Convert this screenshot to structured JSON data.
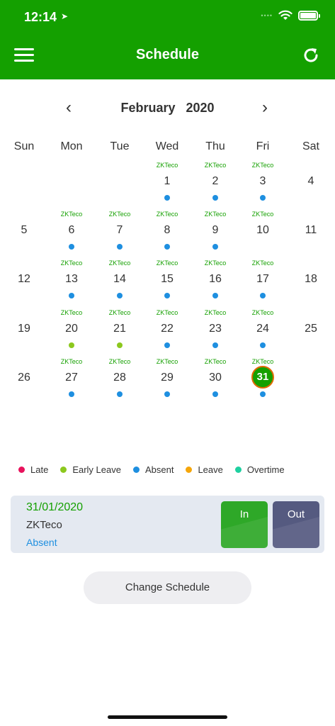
{
  "status_bar": {
    "time": "12:14",
    "signal": "••••"
  },
  "header": {
    "title": "Schedule",
    "menu_icon": "hamburger-menu-icon",
    "refresh_icon": "refresh-icon"
  },
  "calendar": {
    "month": "February",
    "year": "2020",
    "weekdays": [
      "Sun",
      "Mon",
      "Tue",
      "Wed",
      "Thu",
      "Fri",
      "Sat"
    ],
    "weeks": [
      [
        {
          "day": ""
        },
        {
          "day": ""
        },
        {
          "day": ""
        },
        {
          "day": "1",
          "tag": "ZKTeco",
          "status": "absent"
        },
        {
          "day": "2",
          "tag": "ZKTeco",
          "status": "absent"
        },
        {
          "day": "3",
          "tag": "ZKTeco",
          "status": "absent"
        },
        {
          "day": "4"
        }
      ],
      [
        {
          "day": "5"
        },
        {
          "day": "6",
          "tag": "ZKTeco",
          "status": "absent"
        },
        {
          "day": "7",
          "tag": "ZKTeco",
          "status": "absent"
        },
        {
          "day": "8",
          "tag": "ZKTeco",
          "status": "absent"
        },
        {
          "day": "9",
          "tag": "ZKTeco",
          "status": "absent"
        },
        {
          "day": "10",
          "tag": "ZKTeco"
        },
        {
          "day": "11"
        }
      ],
      [
        {
          "day": "12"
        },
        {
          "day": "13",
          "tag": "ZKTeco",
          "status": "absent"
        },
        {
          "day": "14",
          "tag": "ZKTeco",
          "status": "absent"
        },
        {
          "day": "15",
          "tag": "ZKTeco",
          "status": "absent"
        },
        {
          "day": "16",
          "tag": "ZKTeco",
          "status": "absent"
        },
        {
          "day": "17",
          "tag": "ZKTeco",
          "status": "absent"
        },
        {
          "day": "18"
        }
      ],
      [
        {
          "day": "19"
        },
        {
          "day": "20",
          "tag": "ZKTeco",
          "status": "early_leave"
        },
        {
          "day": "21",
          "tag": "ZKTeco",
          "status": "early_leave"
        },
        {
          "day": "22",
          "tag": "ZKTeco",
          "status": "absent"
        },
        {
          "day": "23",
          "tag": "ZKTeco",
          "status": "absent"
        },
        {
          "day": "24",
          "tag": "ZKTeco",
          "status": "absent"
        },
        {
          "day": "25"
        }
      ],
      [
        {
          "day": "26"
        },
        {
          "day": "27",
          "tag": "ZKTeco",
          "status": "absent"
        },
        {
          "day": "28",
          "tag": "ZKTeco",
          "status": "absent"
        },
        {
          "day": "29",
          "tag": "ZKTeco",
          "status": "absent"
        },
        {
          "day": "30",
          "tag": "ZKTeco",
          "status": "absent"
        },
        {
          "day": "31",
          "tag": "ZKTeco",
          "status": "absent",
          "selected": true
        },
        {
          "day": ""
        }
      ]
    ]
  },
  "legend": [
    {
      "key": "late",
      "label": "Late",
      "color": "#e8125c"
    },
    {
      "key": "early_leave",
      "label": "Early Leave",
      "color": "#8cc81e"
    },
    {
      "key": "absent",
      "label": "Absent",
      "color": "#1e8fe0"
    },
    {
      "key": "leave",
      "label": "Leave",
      "color": "#f5a60a"
    },
    {
      "key": "overtime",
      "label": "Overtime",
      "color": "#1ed0a0"
    }
  ],
  "record": {
    "date": "31/01/2020",
    "name": "ZKTeco",
    "status": "Absent",
    "in_label": "In",
    "out_label": "Out"
  },
  "actions": {
    "change_schedule": "Change Schedule"
  },
  "colors": {
    "brand": "#14a000",
    "today_border": "#e06a00",
    "in_button": "#2ea828",
    "out_button": "#555a80"
  }
}
